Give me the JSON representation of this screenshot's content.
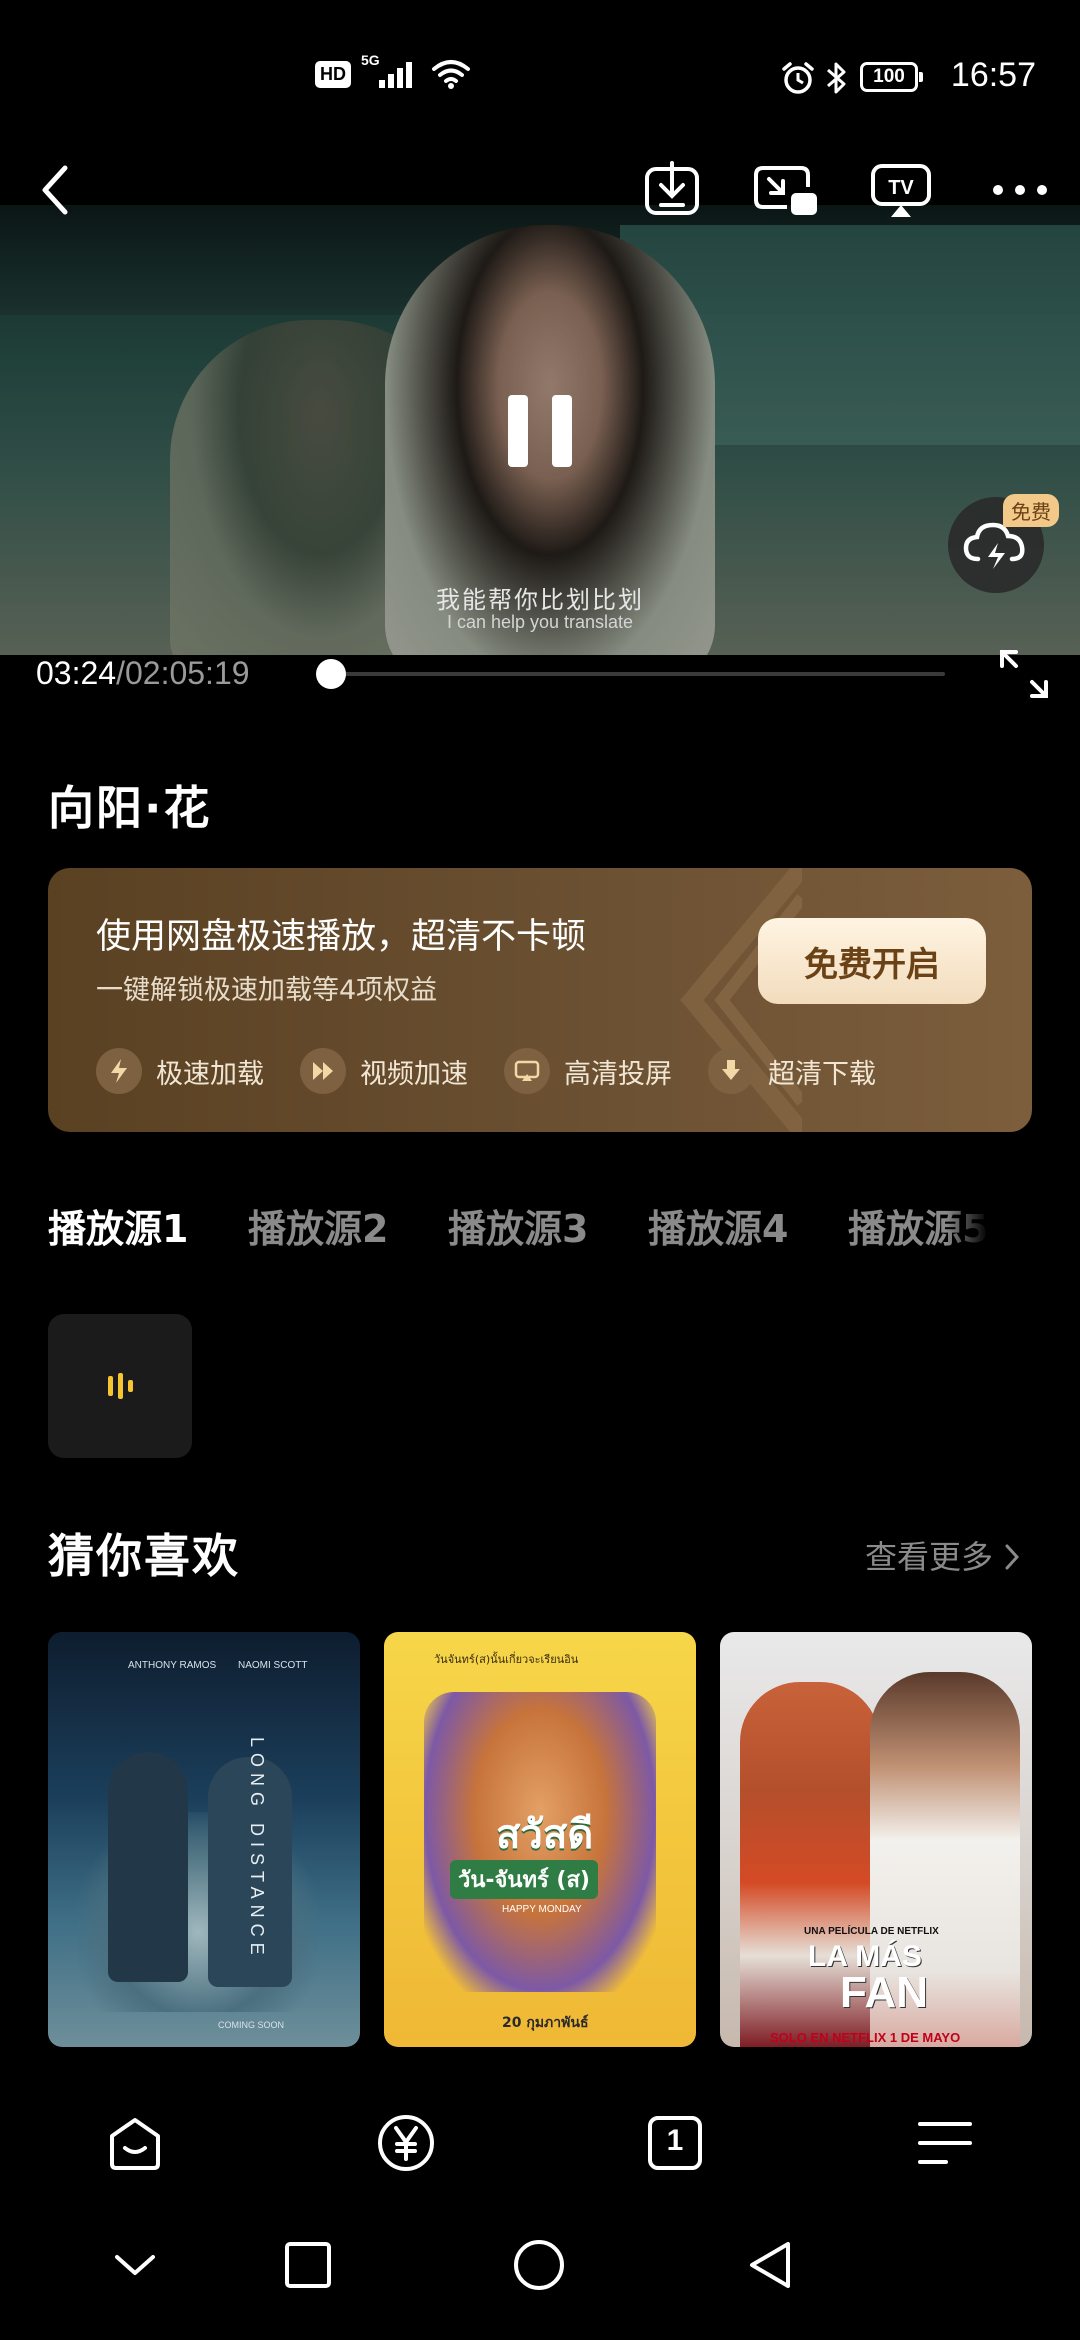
{
  "status_bar": {
    "hd_badge": "HD",
    "network": "5G",
    "battery": "100",
    "time": "16:57"
  },
  "player": {
    "subtitle_cn": "我能帮你比划比划",
    "subtitle_en": "I can help you translate",
    "current_time": "03:24",
    "duration": "/02:05:19",
    "progress": 0.0,
    "free_badge": "免费",
    "state": "playing",
    "icons": [
      "back-icon",
      "download-icon",
      "pip-icon",
      "tv-cast-icon",
      "more-icon",
      "pause-icon",
      "cloud-speed-icon",
      "fullscreen-icon"
    ]
  },
  "video": {
    "title": "向阳·花"
  },
  "promo": {
    "title": "使用网盘极速播放，超清不卡顿",
    "subtitle": "一键解锁极速加载等4项权益",
    "cta": "免费开启",
    "features": [
      {
        "icon": "lightning-icon",
        "label": "极速加载"
      },
      {
        "icon": "fast-forward-icon",
        "label": "视频加速"
      },
      {
        "icon": "cast-screen-icon",
        "label": "高清投屏"
      },
      {
        "icon": "download-arrow-icon",
        "label": "超清下载"
      }
    ],
    "accent": "#6b5032"
  },
  "sources": {
    "tabs": [
      "播放源1",
      "播放源2",
      "播放源3",
      "播放源4",
      "播放源5"
    ],
    "active_index": 0,
    "episode_indicator": "playing-bars-icon",
    "indicator_color": "#f5c532"
  },
  "recommendations": {
    "title": "猜你喜欢",
    "more": "查看更多",
    "posters": [
      {
        "credits_left": "ANTHONY RAMOS",
        "credits_right": "NAOMI SCOTT",
        "title": "LONG DISTANCE",
        "footer": "COMING SOON"
      },
      {
        "top_text": "วันจันทร์(ส)นั้นเกี่ยวจะเรียนอิน",
        "title_line1": "สวัสดี",
        "title_line2": "วัน-จันทร์ (ส)",
        "tagline": "HAPPY MONDAY",
        "footer": "20 กุมภาพันธ์"
      },
      {
        "tagline": "UNA PELÍCULA DE NETFLIX",
        "title_line1": "LA MÁS",
        "title_line2": "FAN",
        "footer": "SOLO EN NETFLIX 1 DE MAYO"
      }
    ]
  },
  "bottom_nav": {
    "items": [
      "home-icon",
      "yen-icon",
      "tabs-icon",
      "menu-icon"
    ],
    "tab_count": "1"
  },
  "system_nav": {
    "items": [
      "collapse-icon",
      "recents-icon",
      "home-circle-icon",
      "back-triangle-icon"
    ]
  }
}
